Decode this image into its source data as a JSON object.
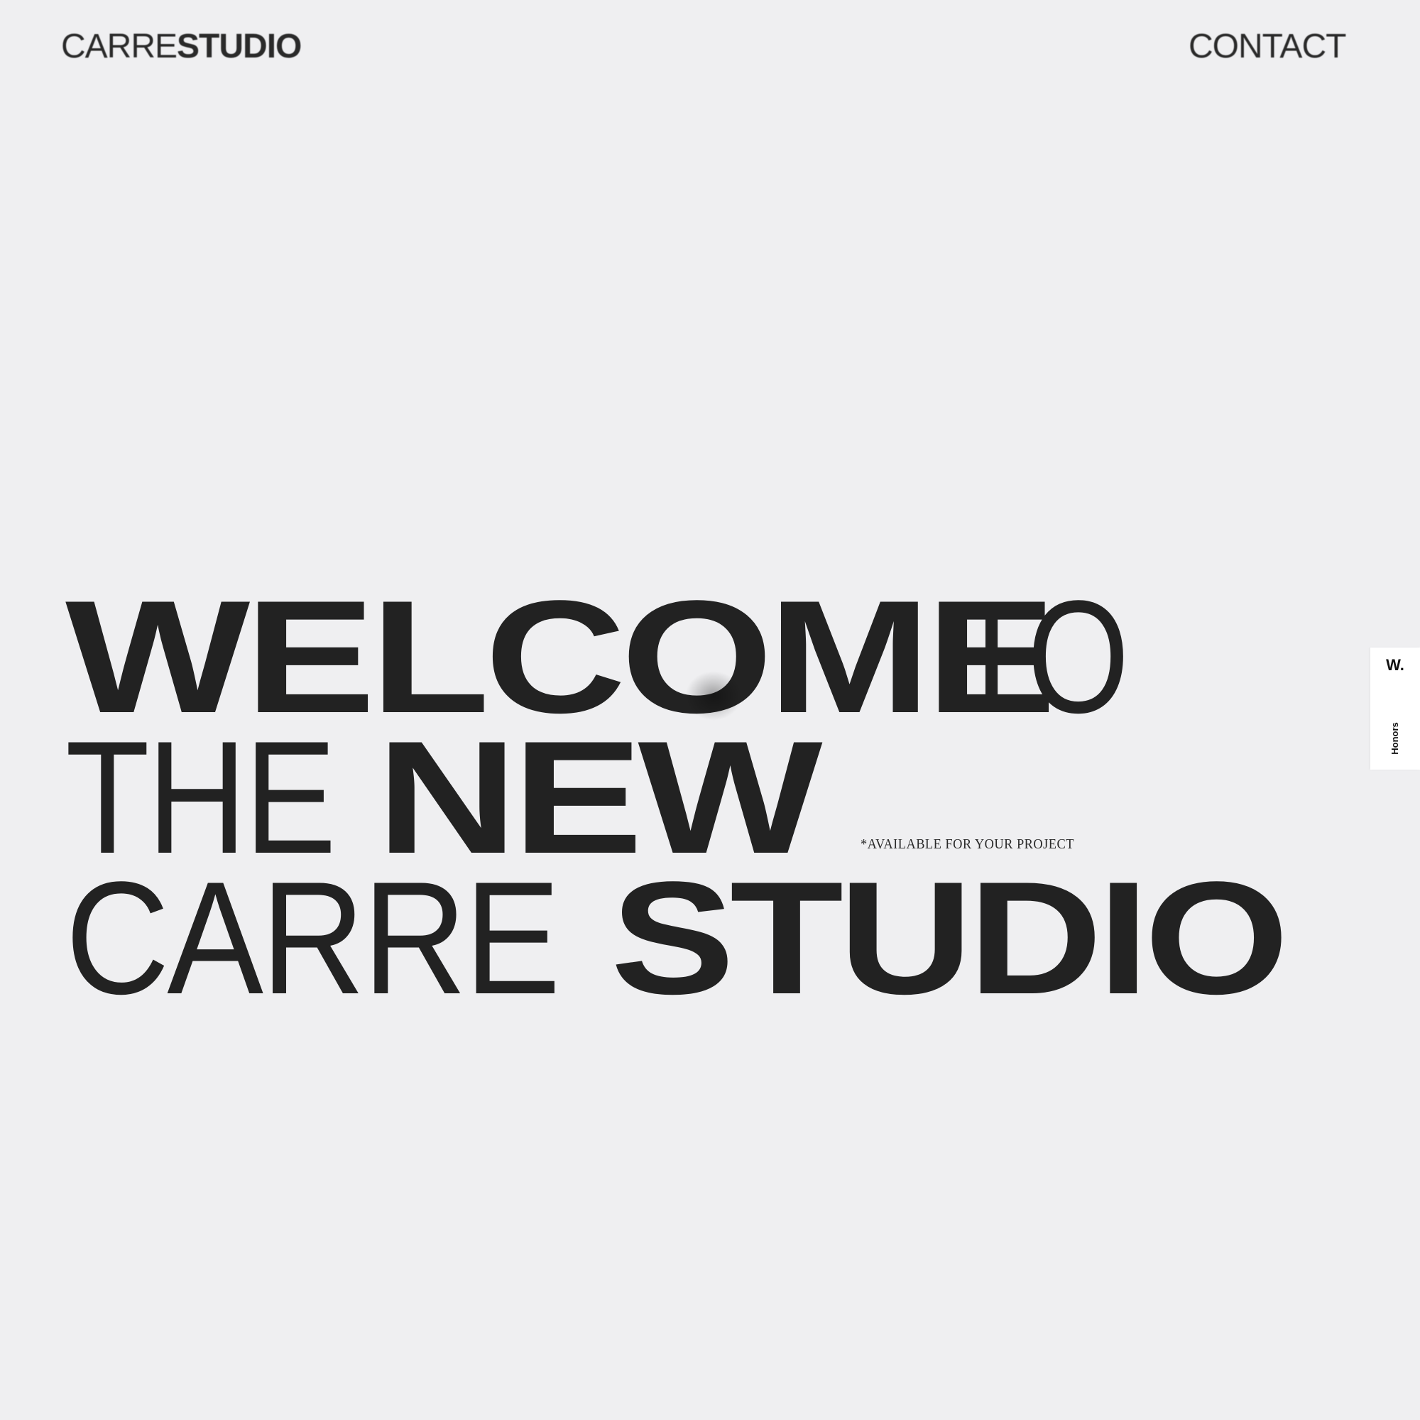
{
  "header": {
    "logo_light": "CARRE",
    "logo_bold": "STUDIO",
    "contact_label": "CONTACT"
  },
  "hero": {
    "line1_bold": "WELCOME",
    "line1_light": "TO",
    "line2_light": "THE",
    "line2_bold": "NEW",
    "line3_light": "CARRE",
    "line3_bold": "STUDIO",
    "tagline": "*AVAILABLE FOR YOUR PROJECT"
  },
  "honors_tab": {
    "logo": "W.",
    "label": "Honors"
  },
  "colors": {
    "background": "#efeff1",
    "text": "#222222",
    "tab_background": "#ffffff"
  }
}
